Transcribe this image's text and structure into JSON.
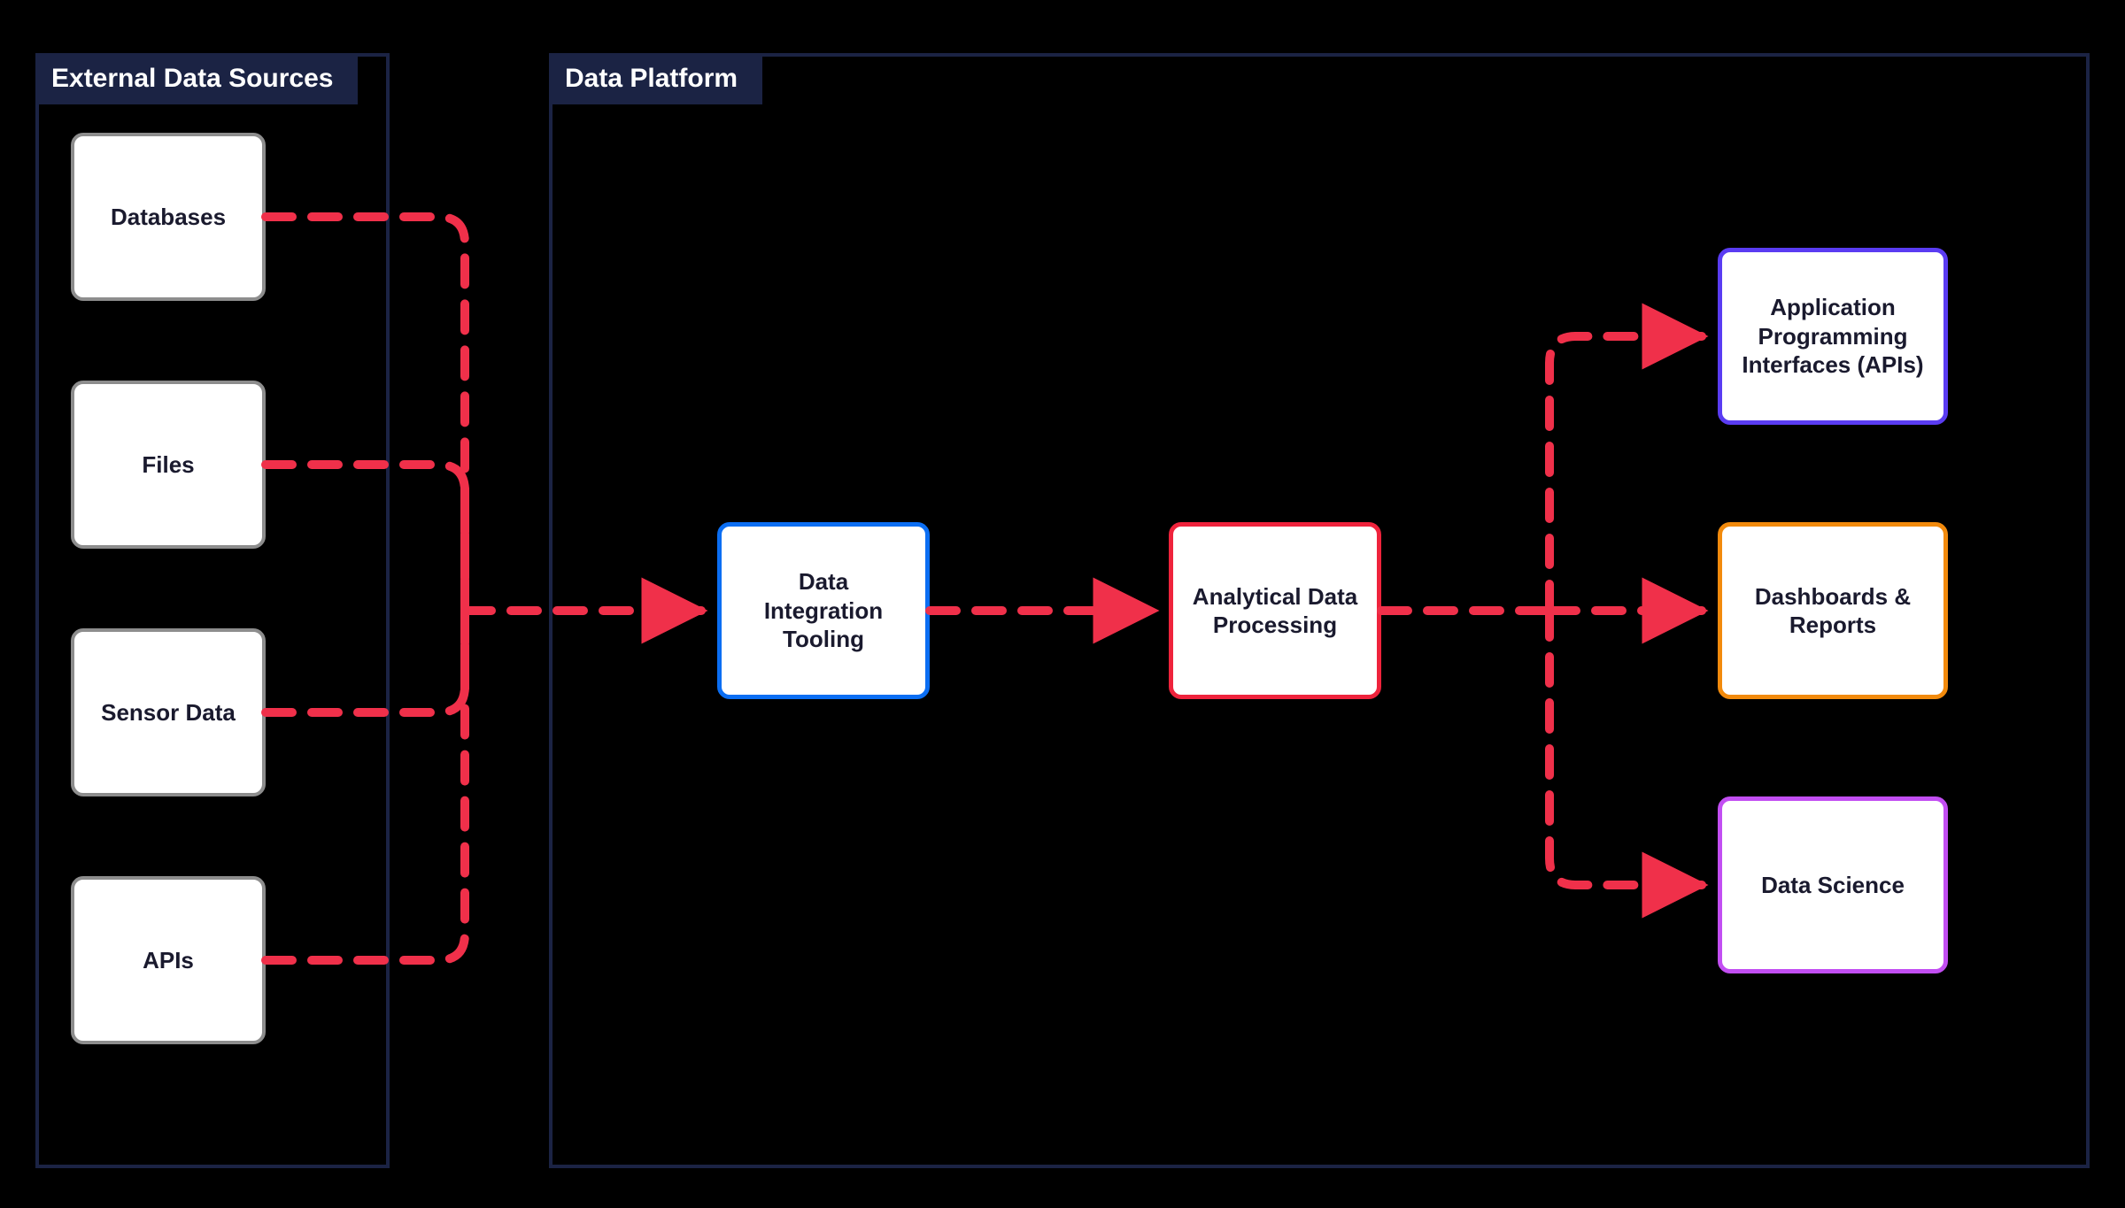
{
  "groups": {
    "external": {
      "title": "External Data Sources"
    },
    "platform": {
      "title": "Data Platform"
    }
  },
  "nodes": {
    "databases": {
      "label": "Databases"
    },
    "files": {
      "label": "Files"
    },
    "sensor": {
      "label": "Sensor Data"
    },
    "apis_src": {
      "label": "APIs"
    },
    "integration": {
      "label": "Data Integration Tooling"
    },
    "analytical": {
      "label": "Analytical Data Processing"
    },
    "apis_out": {
      "label": "Application Programming Interfaces (APIs)"
    },
    "dashboards": {
      "label": "Dashboards & Reports"
    },
    "datascience": {
      "label": "Data Science"
    }
  },
  "colors": {
    "connector": "#f0304a",
    "group_border": "#1b2344",
    "node_gray": "#8d8d8d",
    "node_blue": "#0b6ef3",
    "node_red": "#ef233c",
    "node_indigo": "#5a3cf2",
    "node_orange": "#f28a0c",
    "node_violet": "#c24ef2"
  }
}
